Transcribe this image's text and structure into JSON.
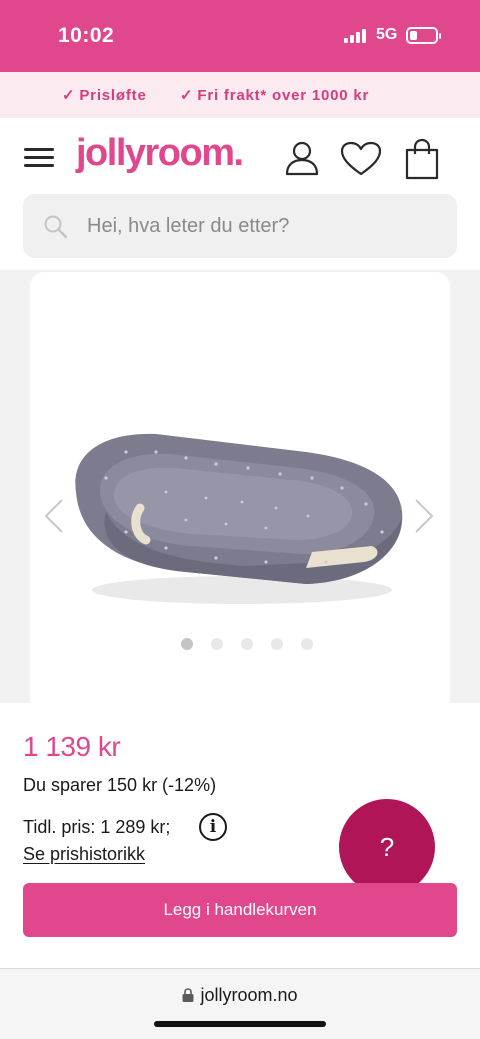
{
  "status_bar": {
    "time": "10:02",
    "network": "5G"
  },
  "promo": {
    "items": [
      "Prisløfte",
      "Fri frakt* over 1000 kr"
    ]
  },
  "header": {
    "logo": "jollyroom."
  },
  "search": {
    "placeholder": "Hei, hva leter du etter?"
  },
  "gallery": {
    "image_count": 5,
    "active_index": 0
  },
  "product": {
    "price": "1 139 kr",
    "savings": "Du sparer 150 kr (-12%)",
    "previous_price": "Tidl. pris: 1 289 kr;",
    "history_link": "Se prishistorikk",
    "add_to_cart": "Legg i handlekurven"
  },
  "help": {
    "label": "?"
  },
  "browser": {
    "url": "jollyroom.no"
  },
  "colors": {
    "brand": "#e0478c",
    "help": "#b01657",
    "promo_bg": "#fceaf1"
  },
  "icons": [
    "menu-icon",
    "account-icon",
    "heart-icon",
    "shopping-bag-icon",
    "search-icon",
    "chevron-left-icon",
    "chevron-right-icon",
    "info-icon",
    "lock-icon"
  ]
}
